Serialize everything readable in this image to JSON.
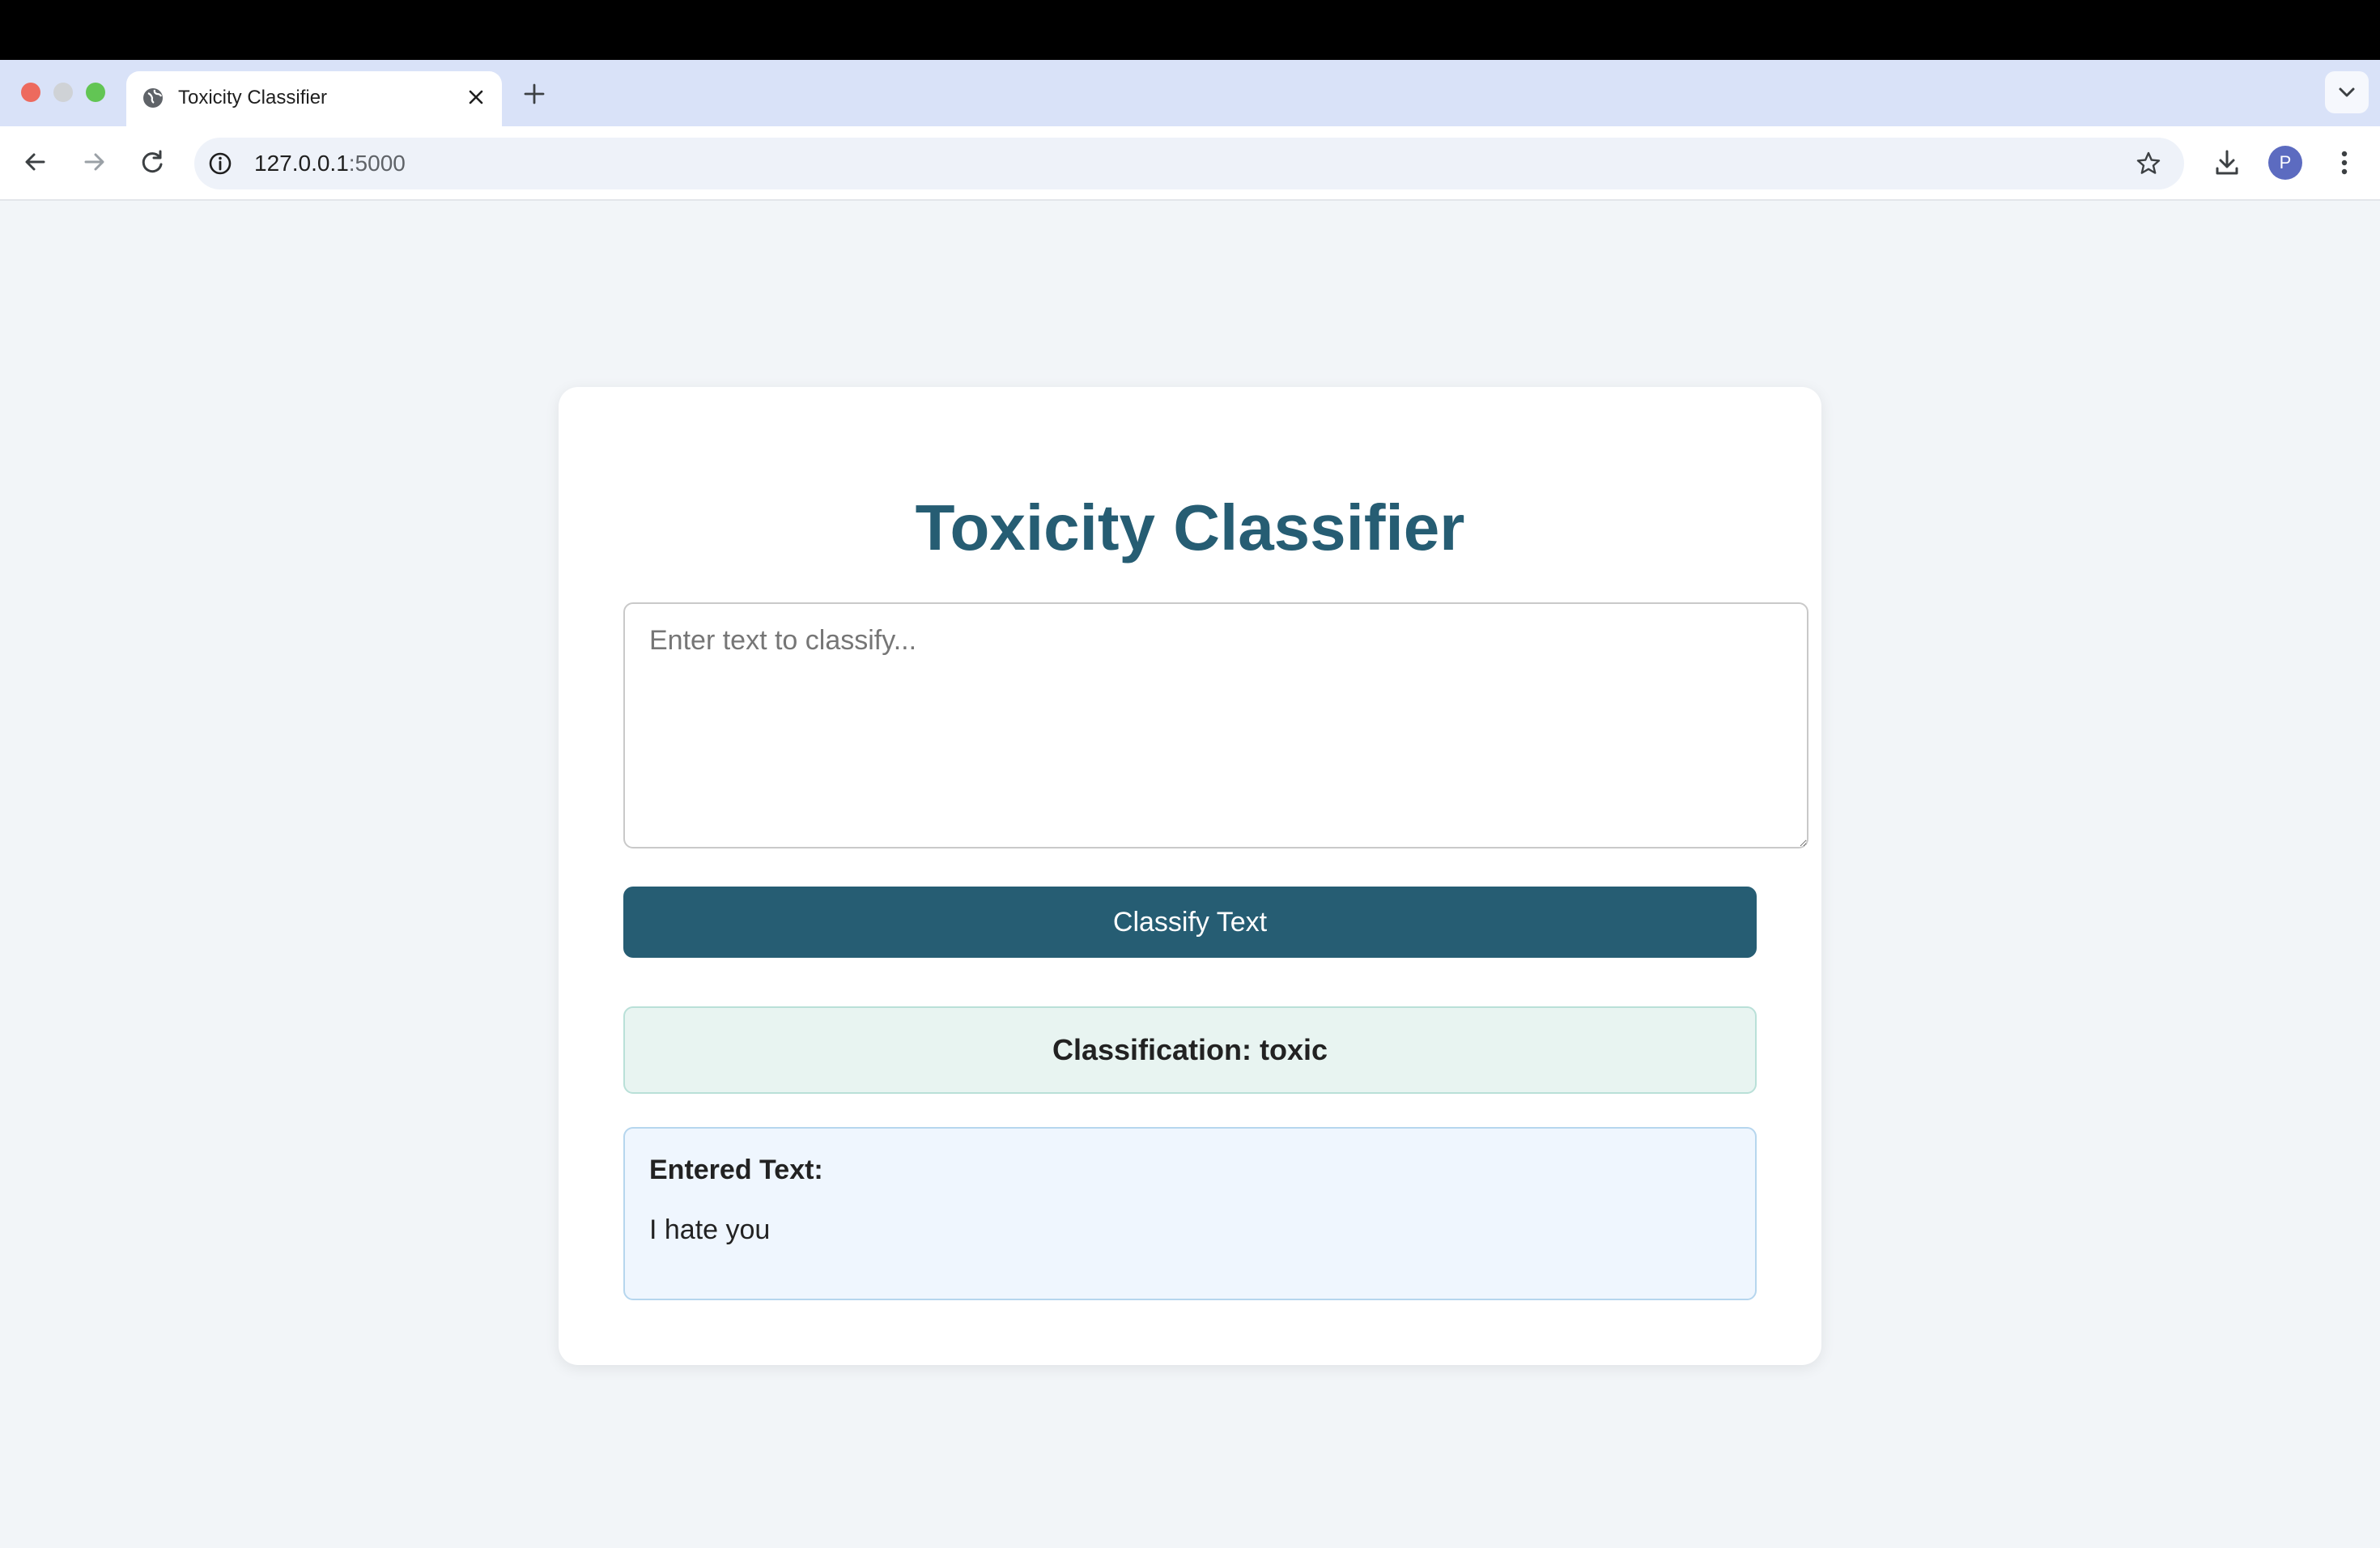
{
  "browser": {
    "tab_title": "Toxicity Classifier",
    "url_host": "127.0.0.1",
    "url_port": ":5000",
    "profile_initial": "P"
  },
  "page": {
    "title": "Toxicity Classifier",
    "input_placeholder": "Enter text to classify...",
    "input_value": "",
    "classify_button_label": "Classify Text",
    "classification_result": "Classification: toxic",
    "entered_text_label": "Entered Text:",
    "entered_text_value": "I hate you"
  },
  "colors": {
    "accent": "#265d73",
    "result_bg": "#e8f4f1",
    "entered_bg": "#eff6fe",
    "page_bg": "#f2f5f8"
  },
  "icons": [
    "globe-icon",
    "close-icon",
    "plus-icon",
    "chevron-down-icon",
    "back-arrow-icon",
    "forward-arrow-icon",
    "reload-icon",
    "info-icon",
    "star-icon",
    "download-icon",
    "more-vert-icon"
  ]
}
